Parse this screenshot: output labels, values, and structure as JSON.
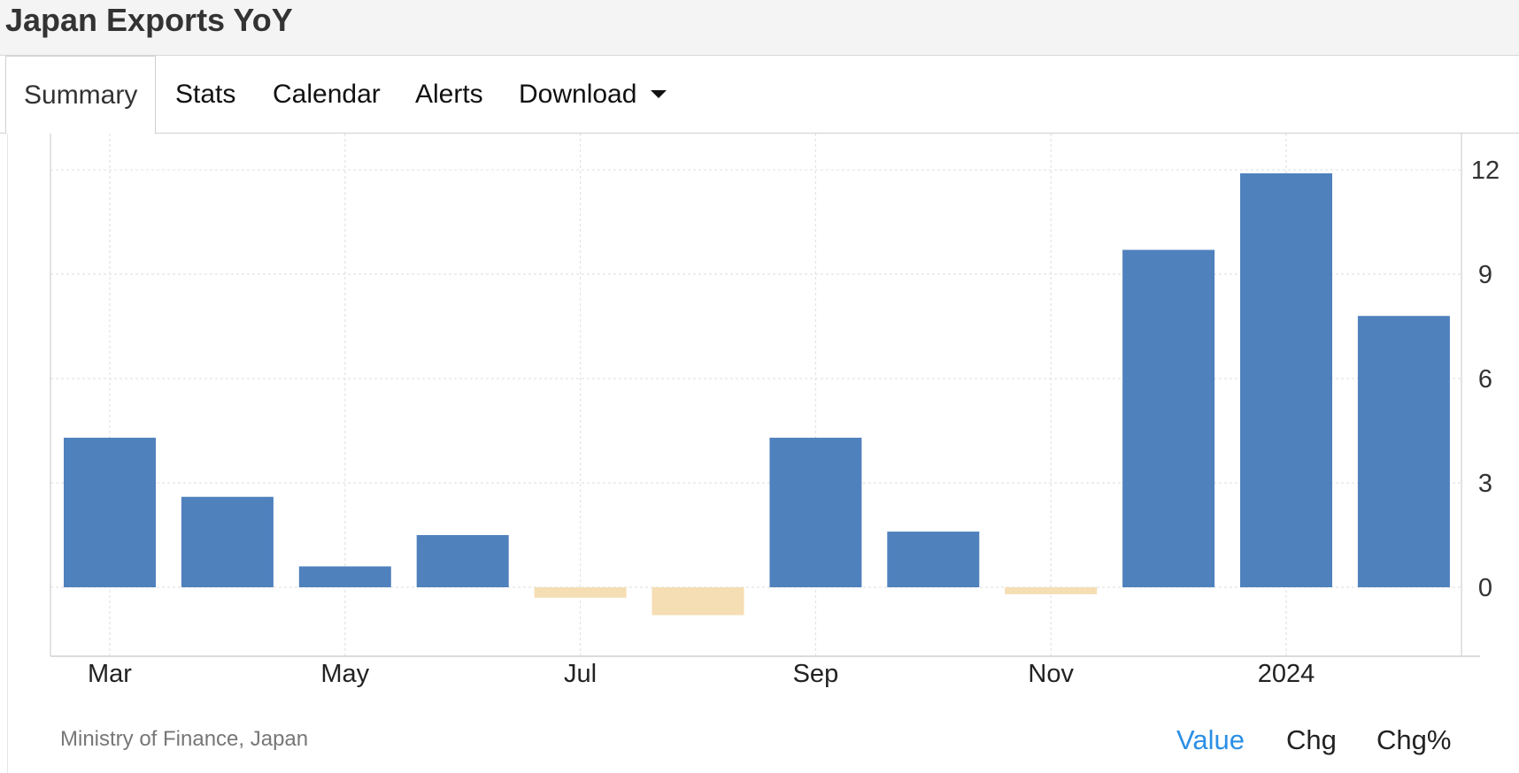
{
  "header": {
    "title": "Japan Exports YoY"
  },
  "tabs": [
    {
      "label": "Summary",
      "active": true
    },
    {
      "label": "Stats"
    },
    {
      "label": "Calendar"
    },
    {
      "label": "Alerts"
    },
    {
      "label": "Download",
      "has_dropdown": true
    }
  ],
  "footer": {
    "source": "Ministry of Finance, Japan",
    "modes": [
      {
        "label": "Value",
        "active": true
      },
      {
        "label": "Chg"
      },
      {
        "label": "Chg%"
      }
    ]
  },
  "colors": {
    "positive_bar": "#4f81bd",
    "negative_bar": "#f5deb3",
    "active_mode": "#2b8fe5"
  },
  "chart_data": {
    "type": "bar",
    "x_tick_labels": [
      "Mar",
      "May",
      "Jul",
      "Sep",
      "Nov",
      "2024"
    ],
    "categories": [
      "Mar 2023",
      "Apr 2023",
      "May 2023",
      "Jun 2023",
      "Jul 2023",
      "Aug 2023",
      "Sep 2023",
      "Oct 2023",
      "Nov 2023",
      "Dec 2023",
      "Jan 2024",
      "Feb 2024"
    ],
    "values": [
      4.3,
      2.6,
      0.6,
      1.5,
      -0.3,
      -0.8,
      4.3,
      1.6,
      -0.2,
      9.7,
      11.9,
      7.8
    ],
    "y_ticks": [
      0,
      3,
      6,
      9,
      12
    ],
    "ylim": [
      -2,
      13.2
    ],
    "y_axis_side": "right",
    "grid": true,
    "title": "",
    "xlabel": "",
    "ylabel": ""
  }
}
